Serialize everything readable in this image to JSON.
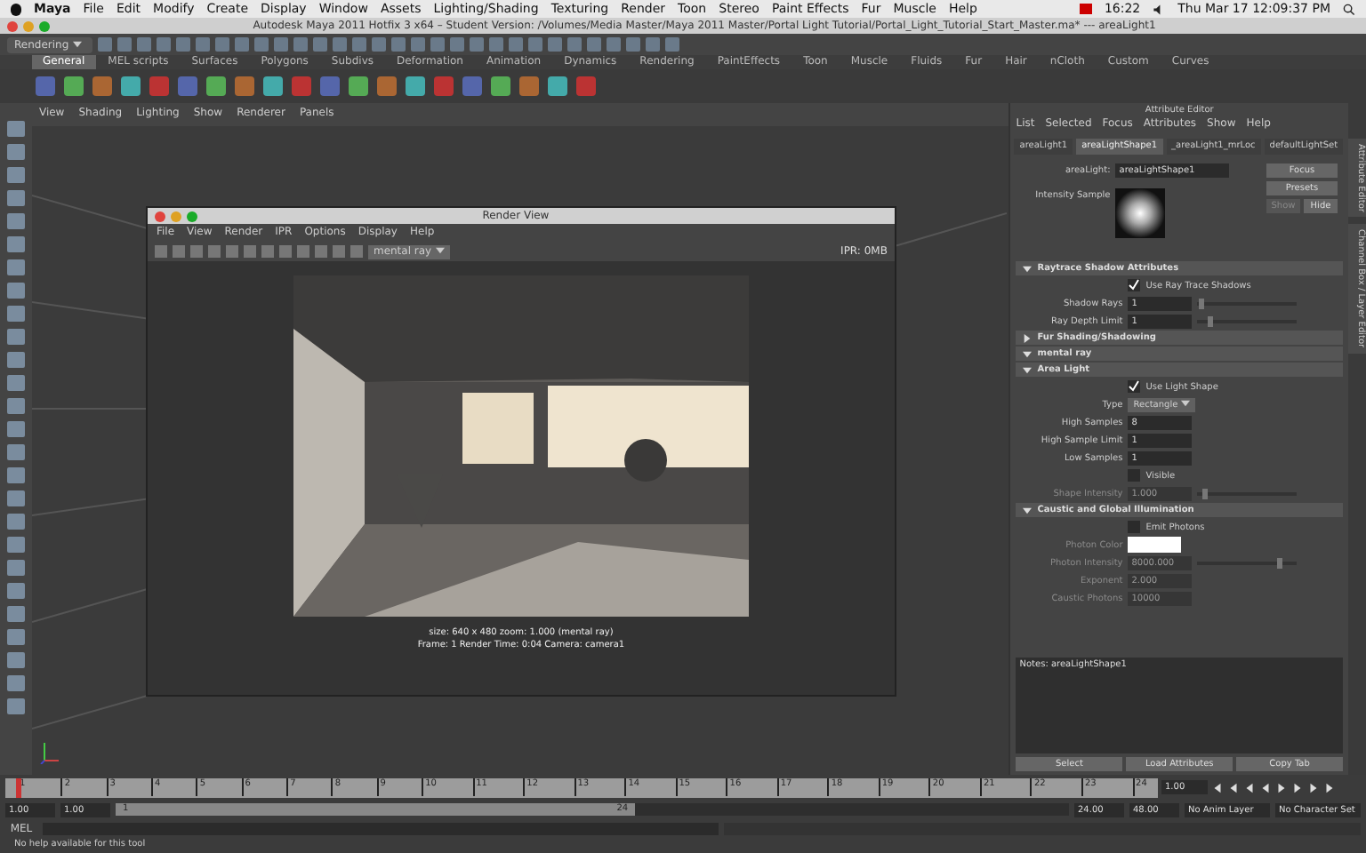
{
  "menubar": {
    "app": "Maya",
    "menus": [
      "File",
      "Edit",
      "Modify",
      "Create",
      "Display",
      "Window",
      "Assets",
      "Lighting/Shading",
      "Texturing",
      "Render",
      "Toon",
      "Stereo",
      "Paint Effects",
      "Fur",
      "Muscle",
      "Help"
    ],
    "time": "16:22",
    "clock": "Thu Mar 17  12:09:37 PM"
  },
  "window": {
    "title": "Autodesk Maya 2011 Hotfix 3 x64 – Student Version: /Volumes/Media Master/Maya 2011 Master/Portal Light Tutorial/Portal_Light_Tutorial_Start_Master.ma*  ---  areaLight1"
  },
  "status_line": {
    "mode": "Rendering"
  },
  "shelf": {
    "tabs": [
      {
        "label": "General",
        "selected": true
      },
      {
        "label": "MEL scripts",
        "selected": false
      },
      {
        "label": "Surfaces",
        "selected": false
      },
      {
        "label": "Polygons",
        "selected": false
      },
      {
        "label": "Subdivs",
        "selected": false
      },
      {
        "label": "Deformation",
        "selected": false
      },
      {
        "label": "Animation",
        "selected": false
      },
      {
        "label": "Dynamics",
        "selected": false
      },
      {
        "label": "Rendering",
        "selected": false
      },
      {
        "label": "PaintEffects",
        "selected": false
      },
      {
        "label": "Toon",
        "selected": false
      },
      {
        "label": "Muscle",
        "selected": false
      },
      {
        "label": "Fluids",
        "selected": false
      },
      {
        "label": "Fur",
        "selected": false
      },
      {
        "label": "Hair",
        "selected": false
      },
      {
        "label": "nCloth",
        "selected": false
      },
      {
        "label": "Custom",
        "selected": false
      },
      {
        "label": "Curves",
        "selected": false
      }
    ]
  },
  "viewport": {
    "menus": [
      "View",
      "Shading",
      "Lighting",
      "Show",
      "Renderer",
      "Panels"
    ]
  },
  "render_view": {
    "title": "Render View",
    "menus": [
      "File",
      "View",
      "Render",
      "IPR",
      "Options",
      "Display",
      "Help"
    ],
    "renderer": "mental ray",
    "ipr": "IPR: 0MB",
    "info_lines": [
      "size: 640 x 480  zoom: 1.000     (mental ray)",
      "Frame: 1     Render Time: 0:04     Camera: camera1"
    ]
  },
  "attribute_editor": {
    "title": "Attribute Editor",
    "menus": [
      "List",
      "Selected",
      "Focus",
      "Attributes",
      "Show",
      "Help"
    ],
    "tabs": [
      {
        "label": "areaLight1",
        "selected": false
      },
      {
        "label": "areaLightShape1",
        "selected": true
      },
      {
        "label": "_areaLight1_mrLoc",
        "selected": false
      },
      {
        "label": "defaultLightSet",
        "selected": false
      }
    ],
    "node_label": "areaLight:",
    "node_name": "areaLightShape1",
    "buttons": [
      {
        "label": "Focus",
        "disabled": false
      },
      {
        "label": "Presets",
        "disabled": false
      },
      {
        "label": "Show",
        "disabled": true
      },
      {
        "label": "Hide",
        "disabled": false
      }
    ],
    "sample_label": "Intensity Sample",
    "rows": [
      {
        "kind": "section",
        "label": "Raytrace Shadow Attributes",
        "expanded": true
      },
      {
        "kind": "checkbox",
        "label": "Use Ray Trace Shadows",
        "checked": true
      },
      {
        "kind": "number",
        "label": "Shadow Rays",
        "value": "1",
        "disabled": false,
        "level": 0.02
      },
      {
        "kind": "number",
        "label": "Ray Depth Limit",
        "value": "1",
        "disabled": false,
        "level": 0.1
      },
      {
        "kind": "section",
        "label": "Fur Shading/Shadowing",
        "expanded": false
      },
      {
        "kind": "section",
        "label": "mental ray",
        "expanded": true
      },
      {
        "kind": "section",
        "label": "Area Light",
        "expanded": true
      },
      {
        "kind": "checkbox",
        "label": "Use Light Shape",
        "checked": true
      },
      {
        "kind": "dropdown",
        "label": "Type",
        "value": "Rectangle"
      },
      {
        "kind": "number",
        "label": "High Samples",
        "value": "8",
        "disabled": false
      },
      {
        "kind": "number",
        "label": "High Sample Limit",
        "value": "1",
        "disabled": false
      },
      {
        "kind": "number",
        "label": "Low Samples",
        "value": "1",
        "disabled": false
      },
      {
        "kind": "checkbox",
        "label": "Visible",
        "checked": false
      },
      {
        "kind": "number",
        "label": "Shape Intensity",
        "value": "1.000",
        "disabled": true,
        "level": 0.05
      },
      {
        "kind": "section",
        "label": "Caustic and Global Illumination",
        "expanded": true
      },
      {
        "kind": "checkbox",
        "label": "Emit Photons",
        "checked": false
      },
      {
        "kind": "color",
        "label": "Photon Color",
        "color": "#ffffff"
      },
      {
        "kind": "number",
        "label": "Photon Intensity",
        "value": "8000.000",
        "disabled": true,
        "level": 0.8
      },
      {
        "kind": "number",
        "label": "Exponent",
        "value": "2.000",
        "disabled": true
      },
      {
        "kind": "number",
        "label": "Caustic Photons",
        "value": "10000",
        "disabled": true
      }
    ],
    "notes_label": "Notes:  areaLightShape1",
    "actions": [
      "Select",
      "Load Attributes",
      "Copy Tab"
    ]
  },
  "side_tabs": [
    "Attribute Editor",
    "Channel Box / Layer Editor"
  ],
  "time_slider": {
    "ticks": [
      "1",
      "2",
      "3",
      "4",
      "5",
      "6",
      "7",
      "8",
      "9",
      "10",
      "11",
      "12",
      "13",
      "14",
      "15",
      "16",
      "17",
      "18",
      "19",
      "20",
      "21",
      "22",
      "23",
      "24"
    ],
    "current_frame": "1.00",
    "level": 0
  },
  "range_slider": {
    "start": "1.00",
    "min": "1.00",
    "range_start": "1",
    "range_end": "24",
    "level": 0.53,
    "end": "24.00",
    "max": "48.00",
    "anim_layer": "No Anim Layer",
    "character_set": "No Character Set"
  },
  "command_line": {
    "label": "MEL"
  },
  "help_line": "No help available for this tool"
}
